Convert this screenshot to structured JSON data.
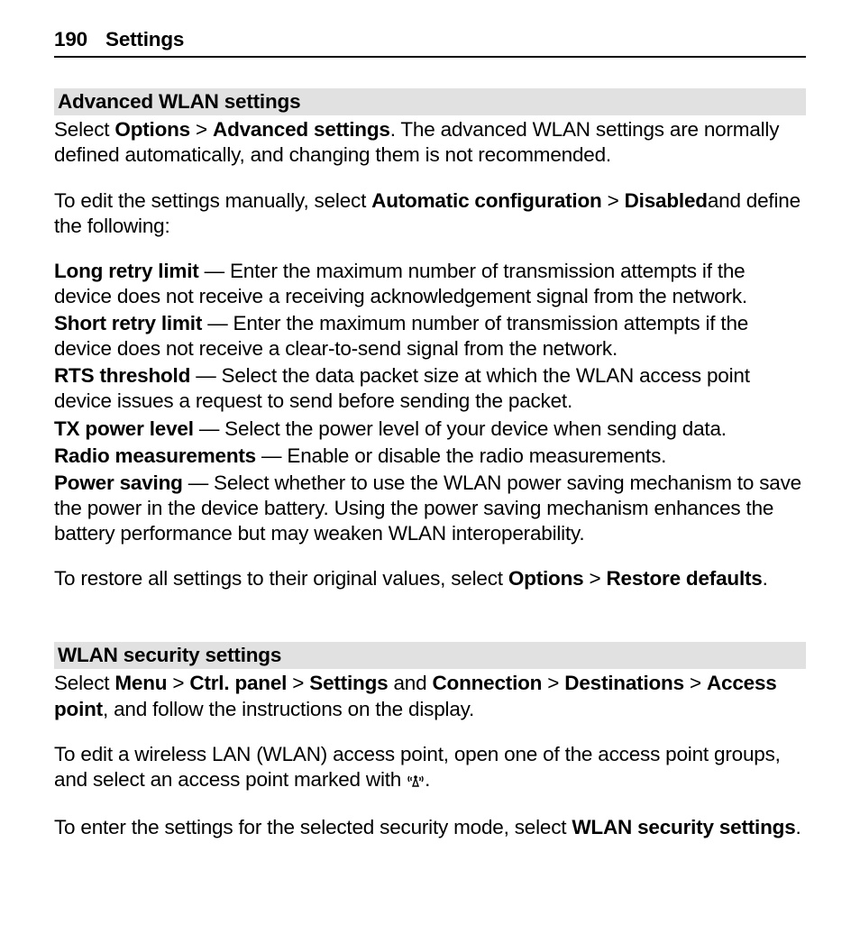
{
  "header": {
    "pageNumber": "190",
    "title": "Settings"
  },
  "section1": {
    "heading": "Advanced WLAN settings",
    "intro": {
      "pre": "Select ",
      "opt": "Options",
      "gt1": " > ",
      "adv": "Advanced settings",
      "post": ". The advanced WLAN settings are normally defined automatically, and changing them is not recommended."
    },
    "manual": {
      "pre": "To edit the settings manually, select ",
      "auto": "Automatic configuration",
      "gt": " > ",
      "dis": "Disabled",
      "post": "and define the following:"
    },
    "items": [
      {
        "term": "Long retry limit",
        "desc": "  — Enter the maximum number of transmission attempts if the device does not receive a receiving acknowledgement signal from the network."
      },
      {
        "term": "Short retry limit",
        "desc": "  — Enter the maximum number of transmission attempts if the device does not receive a clear-to-send signal from the network."
      },
      {
        "term": "RTS threshold",
        "desc": "  — Select the data packet size at which the WLAN access point device issues a request to send before sending the packet."
      },
      {
        "term": "TX power level",
        "desc": "  — Select the power level of your device when sending data."
      },
      {
        "term": "Radio measurements",
        "desc": "  — Enable or disable the radio measurements."
      },
      {
        "term": "Power saving",
        "desc": "  — Select whether to use the WLAN power saving mechanism to save the power in the device battery. Using the power saving mechanism enhances the battery performance but may weaken WLAN interoperability."
      }
    ],
    "restore": {
      "pre": "To restore all settings to their original values, select ",
      "opt": "Options",
      "gt": " > ",
      "rd": "Restore defaults",
      "post": "."
    }
  },
  "section2": {
    "heading": "WLAN security settings",
    "nav": {
      "pre": "Select ",
      "menu": "Menu",
      "gt1": " > ",
      "ctrl": "Ctrl. panel",
      "gt2": " > ",
      "settings": "Settings",
      "and": " and ",
      "conn": "Connection",
      "gt3": " > ",
      "dest": "Destinations",
      "gt4": " > ",
      "ap": "Access point",
      "post": ", and follow the instructions on the display."
    },
    "edit": {
      "pre": "To edit a wireless LAN (WLAN) access point, open one of the access point groups, and select an access point marked with ",
      "post": "."
    },
    "enter": {
      "pre": "To enter the settings for the selected security mode, select ",
      "wss": "WLAN security settings",
      "post": "."
    }
  }
}
